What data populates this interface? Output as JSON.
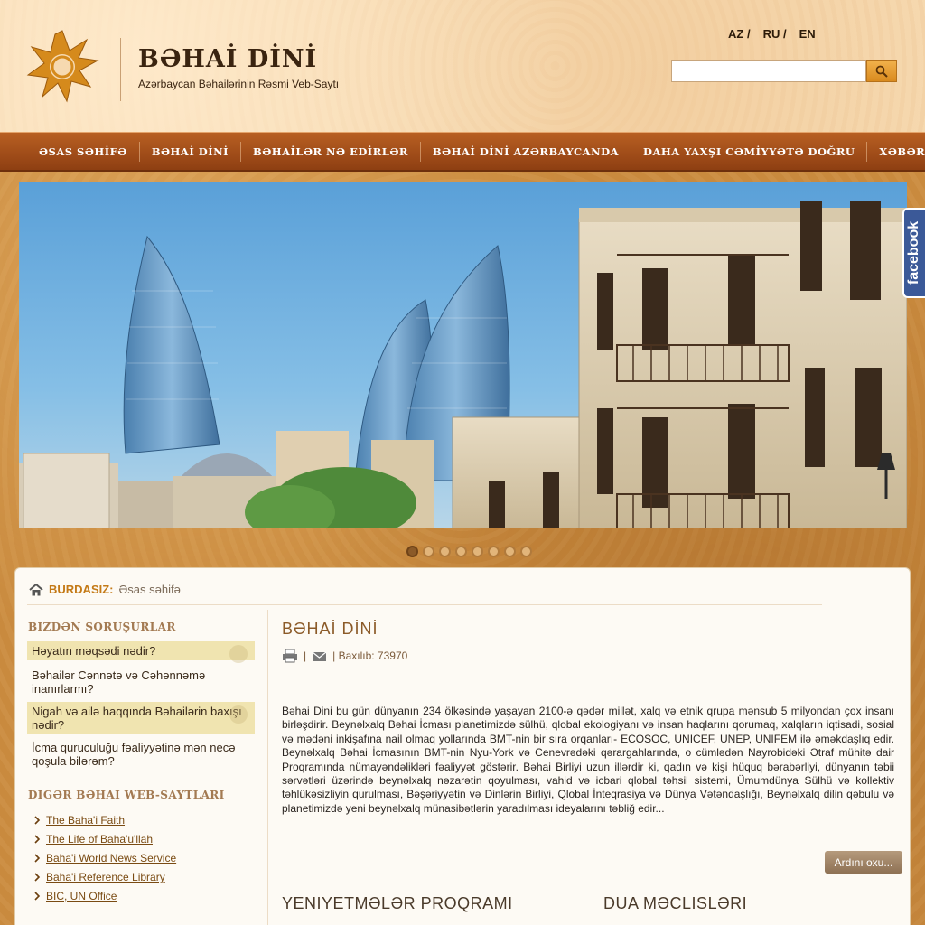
{
  "header": {
    "title": "BƏHAİ DİNİ",
    "subtitle": "Azərbaycan Bəhailərinin Rəsmi Veb-Saytı",
    "languages": [
      "AZ /",
      "RU /",
      "EN"
    ],
    "search": {
      "value": "",
      "placeholder": ""
    }
  },
  "nav": {
    "items": [
      "ƏSAS SƏHİFƏ",
      "BƏHAİ DİNİ",
      "BƏHAİLƏR NƏ EDİRLƏR",
      "BƏHAİ DİNİ AZƏRBAYCANDA",
      "DAHA YAXŞI CƏMİYYƏTƏ DOĞRU",
      "XƏBƏRLƏR"
    ]
  },
  "slider": {
    "slide_count": 8,
    "active_index": 0
  },
  "social": {
    "facebook_label": "facebook"
  },
  "breadcrumb": {
    "label": "BURDASIZ:",
    "page": "Əsas səhifə"
  },
  "sidebar": {
    "faq_heading": "BIZDƏN SORUŞURLAR",
    "faq": [
      "Həyatın məqsədi nədir?",
      "Bəhailər Cənnətə və Cəhənnəmə inanırlarmı?",
      "Nigah və ailə haqqında Bəhailərin baxışı nədir?",
      "İcma quruculuğu fəaliyyətinə mən necə qoşula bilərəm?"
    ],
    "links_heading": "DIGƏR BƏHAI WEB-SAYTLARI",
    "links": [
      "The Baha'i Faith",
      "The Life of Baha'u'llah",
      "Baha'i World News Service",
      "Baha'i Reference Library",
      "BIC, UN Office"
    ]
  },
  "article": {
    "title": "BƏHAİ DİNİ",
    "sep": "|",
    "views": "| Baxılıb: 73970",
    "body": "Bəhai Dini bu gün dünyanın 234 ölkəsində yaşayan 2100-ə qədər millət, xalq və etnik qrupa mənsub 5 milyondan çox insanı birləşdirir. Beynəlxalq Bəhai İcması planetimizdə sülhü, qlobal ekologiyanı və insan haqlarını qorumaq, xalqların iqtisadi, sosial və mədəni inkişafına nail olmaq yollarında BMT-nin bir sıra orqanları- ECOSOC, UNICEF, UNEP, UNIFEM ilə əməkdaşlıq edir. Beynəlxalq Bəhai İcmasının BMT-nin Nyu-York və Cenevrədəki qərargahlarında, o cümlədən Nayrobidəki Ətraf mühitə dair Proqramında nümayəndəlikləri fəaliyyət göstərir. Bəhai Birliyi uzun illərdir ki, qadın və kişi hüquq bərabərliyi, dünyanın təbii sərvətləri üzərində beynəlxalq nəzarətin qoyulması, vahid və icbari qlobal təhsil sistemi, Ümumdünya Sülhü və kollektiv təhlükəsizliyin qurulması, Bəşəriyyətin və Dinlərin Birliyi, Qlobal İnteqrasiya və Dünya Vətəndaşlığı, Beynəlxalq dilin qəbulu və planetimizdə yeni beynəlxalq münasibətlərin yaradılması ideyalarını təbliğ edir...",
    "more": "Ardını oxu..."
  },
  "sections": [
    "YENIYETMƏLƏR PROQRAMI",
    "DUA MƏCLISLƏRI"
  ],
  "colors": {
    "nav": "#a14d1a",
    "accent": "#c47a17",
    "facebook": "#3b5998"
  }
}
